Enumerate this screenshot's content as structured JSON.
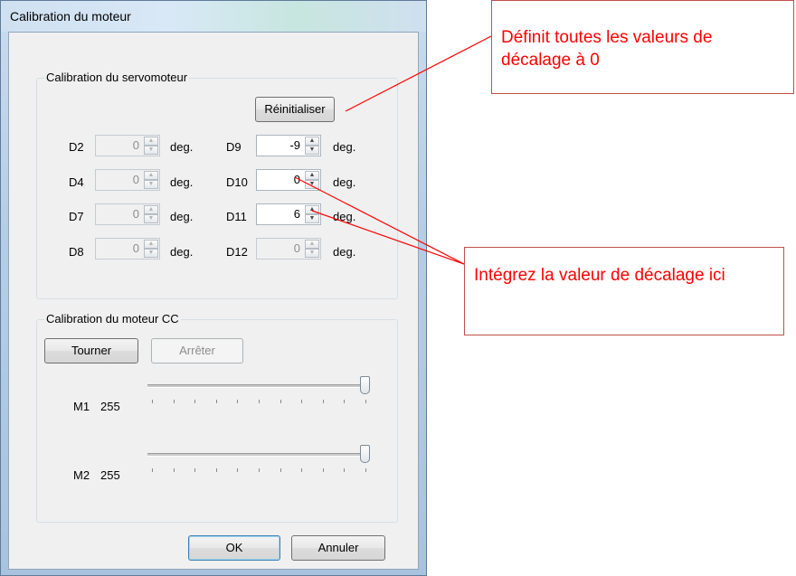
{
  "window": {
    "title": "Calibration du moteur"
  },
  "servo": {
    "group_title": "Calibration du servomoteur",
    "reset_label": "Réinitialiser",
    "unit": "deg.",
    "left": [
      {
        "label": "D2",
        "value": "0"
      },
      {
        "label": "D4",
        "value": "0"
      },
      {
        "label": "D7",
        "value": "0"
      },
      {
        "label": "D8",
        "value": "0"
      }
    ],
    "right": [
      {
        "label": "D9",
        "value": "-9"
      },
      {
        "label": "D10",
        "value": "0"
      },
      {
        "label": "D11",
        "value": "6"
      },
      {
        "label": "D12",
        "value": "0"
      }
    ]
  },
  "dc": {
    "group_title": "Calibration du moteur CC",
    "start_label": "Tourner",
    "stop_label": "Arrêter",
    "motors": [
      {
        "label": "M1",
        "value": "255",
        "level": 1.0
      },
      {
        "label": "M2",
        "value": "255",
        "level": 1.0
      }
    ]
  },
  "footer": {
    "ok_label": "OK",
    "cancel_label": "Annuler"
  },
  "annotations": {
    "reset_note": "Définit toutes les valeurs de décalage à 0",
    "input_note": "Intégrez la valeur de décalage ici"
  },
  "colors": {
    "annotation": "#ff0000",
    "callout_border": "#c0504d"
  }
}
